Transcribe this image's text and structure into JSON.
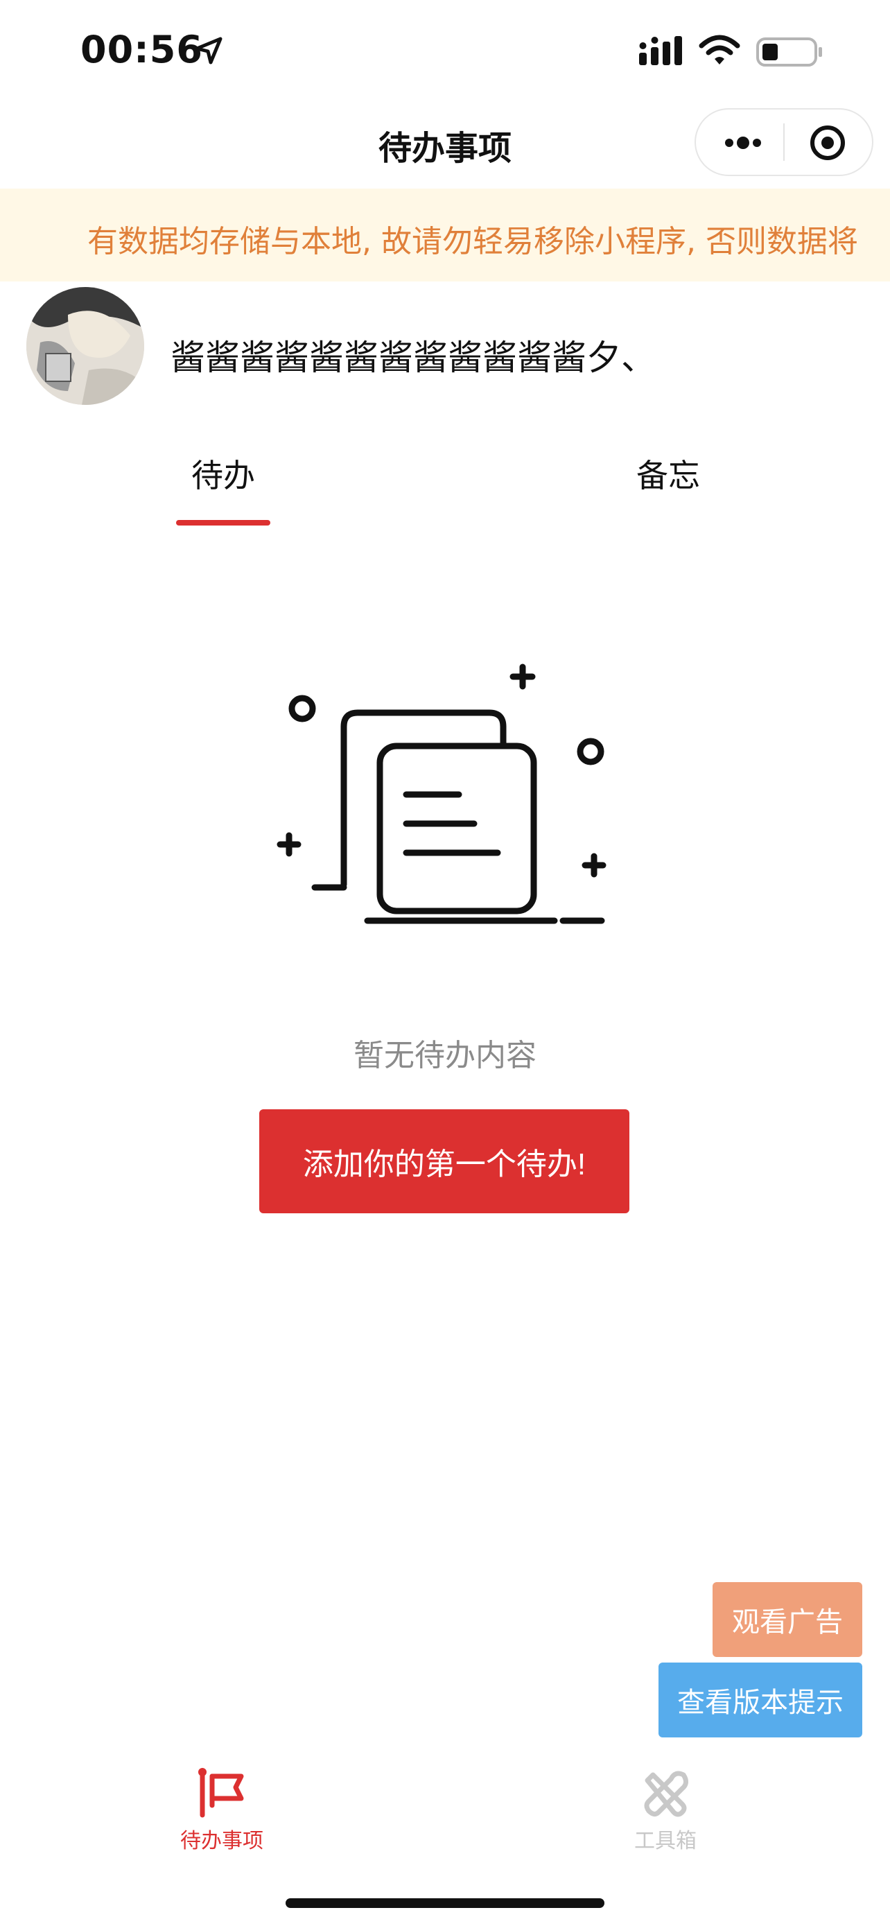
{
  "status_bar": {
    "time": "00:56"
  },
  "nav": {
    "title": "待办事项"
  },
  "notice": {
    "text": "有数据均存储与本地, 故请勿轻易移除小程序, 否则数据将"
  },
  "profile": {
    "username": "酱酱酱酱酱酱酱酱酱酱酱酱夕、"
  },
  "tabs": {
    "todo": "待办",
    "memo": "备忘",
    "active": "todo"
  },
  "empty_state": {
    "text": "暂无待办内容",
    "button": "添加你的第一个待办!"
  },
  "floating": {
    "ad_button": "观看广告",
    "version_button": "查看版本提示"
  },
  "tabbar": {
    "todo_label": "待办事项",
    "tools_label": "工具箱"
  },
  "colors": {
    "accent": "#dc3030",
    "notice_bg": "#fff8e6",
    "notice_text": "#e0803a",
    "ad_button": "#f0a07a",
    "version_button": "#57acec"
  }
}
